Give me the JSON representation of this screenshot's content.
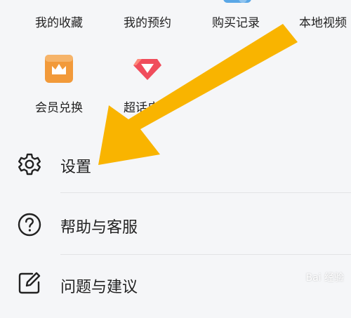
{
  "top_row": {
    "items": [
      {
        "label": "我的收藏"
      },
      {
        "label": "我的预约"
      },
      {
        "label": "购买记录"
      },
      {
        "label": "本地视频"
      }
    ]
  },
  "second_row": {
    "items": [
      {
        "label": "会员兑换",
        "icon": "crown-icon",
        "color": "#f29a3a"
      },
      {
        "label": "超话广场",
        "icon": "diamond-icon",
        "color": "#f04d5c"
      }
    ]
  },
  "menu": {
    "items": [
      {
        "label": "设置",
        "icon": "gear-icon"
      },
      {
        "label": "帮助与客服",
        "icon": "help-circle-icon"
      },
      {
        "label": "问题与建议",
        "icon": "edit-icon"
      }
    ]
  },
  "annotation": {
    "color": "#f9b400"
  },
  "watermark": {
    "text": "Bai 经验"
  }
}
